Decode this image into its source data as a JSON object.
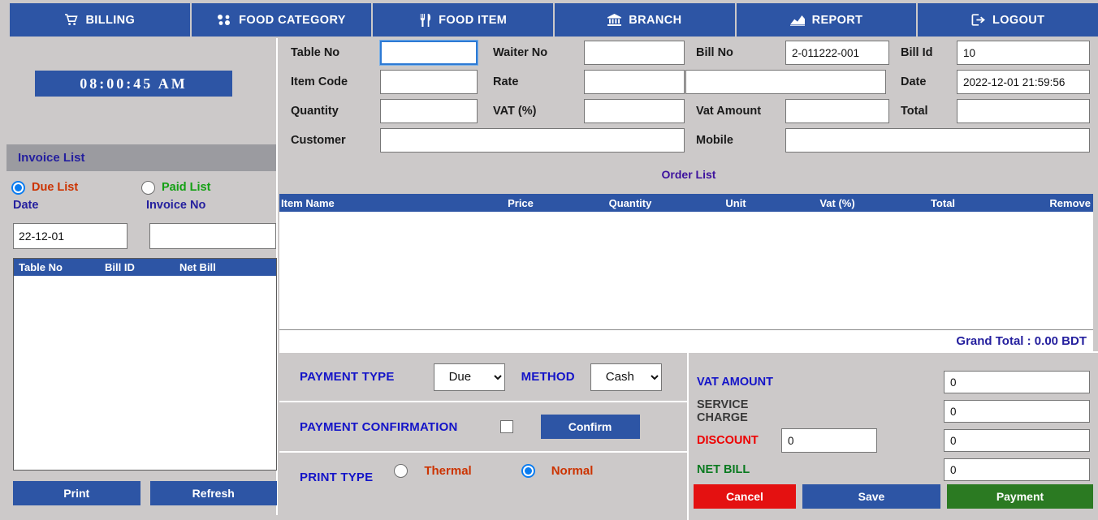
{
  "nav": {
    "items": [
      {
        "label": "BILLING",
        "icon": "cart-icon"
      },
      {
        "label": "FOOD CATEGORY",
        "icon": "category-icon"
      },
      {
        "label": "FOOD ITEM",
        "icon": "cutlery-icon"
      },
      {
        "label": "BRANCH",
        "icon": "bank-icon"
      },
      {
        "label": "REPORT",
        "icon": "chart-icon"
      },
      {
        "label": "LOGOUT",
        "icon": "logout-icon"
      }
    ]
  },
  "left": {
    "clock": "08:00:45 AM",
    "invoice_list_title": "Invoice List",
    "due_list_label": "Due List",
    "paid_list_label": "Paid List",
    "date_label": "Date",
    "invoice_no_label": "Invoice No",
    "date_value": "22-12-01",
    "invoice_no_value": "",
    "table_headers": [
      "Table No",
      "Bill ID",
      "Net Bill"
    ],
    "table_rows": [],
    "print_button": "Print",
    "refresh_button": "Refresh"
  },
  "form": {
    "table_no_label": "Table No",
    "table_no_value": "",
    "waiter_no_label": "Waiter No",
    "waiter_no_value": "",
    "bill_no_label": "Bill No",
    "bill_no_value": "2-011222-001",
    "bill_id_label": "Bill Id",
    "bill_id_value": "10",
    "item_code_label": "Item Code",
    "item_code_value": "",
    "rate_label": "Rate",
    "rate_value": "",
    "extra_value": "",
    "date_label": "Date",
    "date_value": "2022-12-01 21:59:56",
    "quantity_label": "Quantity",
    "quantity_value": "",
    "vat_pct_label": "VAT (%)",
    "vat_pct_value": "",
    "vat_amount_label": "Vat Amount",
    "vat_amount_value": "",
    "total_label": "Total",
    "total_value": "",
    "customer_label": "Customer",
    "customer_value": "",
    "mobile_label": "Mobile",
    "mobile_value": ""
  },
  "order_list": {
    "title": "Order List",
    "columns": [
      "Item Name",
      "Price",
      "Quantity",
      "Unit",
      "Vat (%)",
      "Total",
      "Remove"
    ],
    "rows": [],
    "grand_total": "Grand Total : 0.00 BDT"
  },
  "payment": {
    "payment_type_label": "PAYMENT TYPE",
    "payment_type_value": "Due",
    "payment_type_options": [
      "Due"
    ],
    "method_label": "METHOD",
    "method_value": "Cash",
    "method_options": [
      "Cash"
    ],
    "confirmation_label": "PAYMENT CONFIRMATION",
    "confirmation_checked": false,
    "confirm_button": "Confirm",
    "print_type_label": "PRINT TYPE",
    "thermal_label": "Thermal",
    "normal_label": "Normal",
    "print_type_selected": "Normal"
  },
  "totals": {
    "vat_amount_label": "VAT AMOUNT",
    "vat_amount_value": "0",
    "service_charge_label": "SERVICE CHARGE",
    "service_charge_value": "0",
    "discount_label": "DISCOUNT",
    "discount_input_value": "0",
    "discount_value": "0",
    "net_bill_label": "NET BILL",
    "net_bill_value": "0",
    "cancel_button": "Cancel",
    "save_button": "Save",
    "payment_button": "Payment"
  },
  "colors": {
    "primary_blue": "#2d55a5",
    "panel_gray": "#ccc9c9",
    "header_gray": "#9b9ba0",
    "navy_text": "#241f9e",
    "red": "#cc3300",
    "green": "#13a013",
    "cancel_red": "#e41111",
    "payment_green": "#2b7a22"
  }
}
